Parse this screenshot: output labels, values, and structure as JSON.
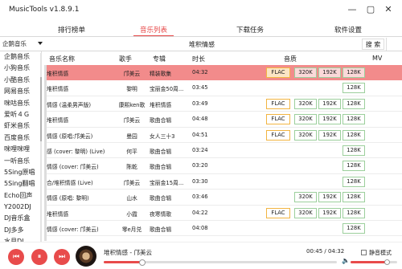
{
  "app": {
    "title": "MusicTools v1.8.9.1"
  },
  "window": {
    "minimize_glyph": "—",
    "maximize_glyph": "▢",
    "close_glyph": "✕"
  },
  "tabs": [
    {
      "label": "排行榜单"
    },
    {
      "label": "音乐列表"
    },
    {
      "label": "下载任务"
    },
    {
      "label": "软件设置"
    }
  ],
  "active_tab": "音乐列表",
  "search": {
    "source": "企鹅音乐",
    "query": "堆积情感",
    "button_label": "搜 索"
  },
  "sources": [
    "企鹅音乐",
    "小狗音乐",
    "小酷音乐",
    "网易音乐",
    "咪咕音乐",
    "爱听４Ｇ",
    "虾米音乐",
    "百度音乐",
    "咪哩咪哩",
    "一听音乐",
    "5Sing原唱",
    "5Sing翻唱",
    "Echo回声",
    "Y2002DJ",
    "DJ音乐盒",
    "DJ多多",
    "水月DJ"
  ],
  "table": {
    "headers": {
      "name": "音乐名称",
      "artist": "歌手",
      "album": "专辑",
      "duration": "时长",
      "quality": "音质",
      "mv": "MV"
    },
    "rows": [
      {
        "name": "堆积情感",
        "artist": "邝美云",
        "album": "精装歌集",
        "duration": "04:32",
        "flac": "FLAC",
        "q320": "320K",
        "q192": "192K",
        "q128": "128K"
      },
      {
        "name": "堆积情感",
        "artist": "黎明",
        "album": "宝丽金50周...",
        "duration": "03:45",
        "flac": "",
        "q320": "",
        "q192": "",
        "q128": "128K"
      },
      {
        "name": "情感 (温柔男声版)",
        "artist": "康熙ken歌",
        "album": "堆积情感",
        "duration": "03:49",
        "flac": "FLAC",
        "q320": "320K",
        "q192": "192K",
        "q128": "128K"
      },
      {
        "name": "堆积情感",
        "artist": "邝美云",
        "album": "歌曲合辑",
        "duration": "04:48",
        "flac": "FLAC",
        "q320": "320K",
        "q192": "192K",
        "q128": "128K"
      },
      {
        "name": "情感 (原唱:邝美云)",
        "artist": "曼园",
        "album": "女人三十3",
        "duration": "04:51",
        "flac": "FLAC",
        "q320": "320K",
        "q192": "192K",
        "q128": "128K"
      },
      {
        "name": "感 (cover: 黎明) (Live)",
        "artist": "何平",
        "album": "歌曲合辑",
        "duration": "03:24",
        "flac": "",
        "q320": "",
        "q192": "",
        "q128": "128K"
      },
      {
        "name": "情感 (cover: 邝美云)",
        "artist": "陈乾",
        "album": "歌曲合辑",
        "duration": "03:20",
        "flac": "",
        "q320": "",
        "q192": "",
        "q128": "128K"
      },
      {
        "name": "合/堆积情感 (Live)",
        "artist": "邝美云",
        "album": "宝丽金15周...",
        "duration": "03:30",
        "flac": "",
        "q320": "",
        "q192": "",
        "q128": "128K"
      },
      {
        "name": "情感 (原唱: 黎明)",
        "artist": "山水",
        "album": "歌曲合辑",
        "duration": "03:46",
        "flac": "",
        "q320": "320K",
        "q192": "192K",
        "q128": "128K"
      },
      {
        "name": "堆积情感",
        "artist": "小霞",
        "album": "夜寒情歌",
        "duration": "04:22",
        "flac": "FLAC",
        "q320": "320K",
        "q192": "192K",
        "q128": "128K"
      },
      {
        "name": "情感 (cover: 邝美云)",
        "artist": "零e月兑",
        "album": "歌曲合辑",
        "duration": "04:08",
        "flac": "",
        "q320": "",
        "q192": "",
        "q128": "128K"
      }
    ]
  },
  "player": {
    "now_playing": "堆积情感 - 邝美云",
    "time": "00:45 / 04:32",
    "progress": 0.166,
    "volume": 0.78,
    "mute_label": "静音模式",
    "prev_glyph": "⏮",
    "pause_glyph": "⏸",
    "next_glyph": "⏭",
    "volume_glyph": "🔈"
  },
  "colors": {
    "accent": "#e64545",
    "selected_row": "#f28b8b",
    "flac_border": "#f2b542",
    "quality_border": "#9ccf9c"
  }
}
